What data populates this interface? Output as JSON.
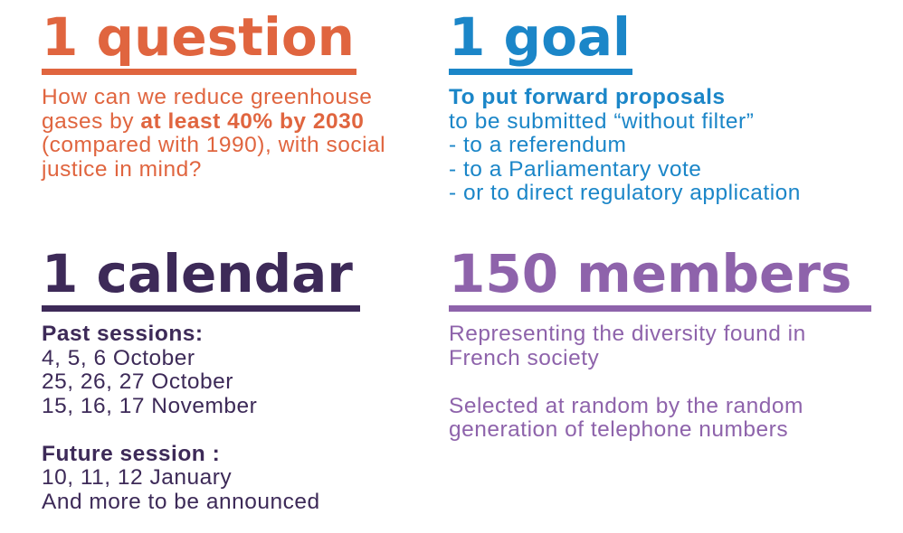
{
  "question": {
    "heading": "1 question",
    "text_a": "How can we reduce greenhouse gases by ",
    "text_bold": "at least 40% by 2030",
    "text_b": " (compared with 1990), with social justice in mind?",
    "color": "#e0653f"
  },
  "goal": {
    "heading": "1 goal",
    "lead": "To put forward proposals",
    "lines": [
      "to be submitted “without filter”",
      "- to a referendum",
      "- to a Parliamentary vote",
      "- or to direct regulatory application"
    ],
    "color": "#1b86c8"
  },
  "calendar": {
    "heading": "1 calendar",
    "past_label": "Past sessions:",
    "past_dates": [
      "4, 5, 6 October",
      "25, 26, 27 October",
      "15, 16, 17 November"
    ],
    "future_label": "Future session :",
    "future_dates": [
      "10, 11, 12 January",
      "And more to be announced"
    ],
    "color": "#3d2a58"
  },
  "members": {
    "heading": "150 members",
    "paragraph_1": "Representing the diversity found in French society",
    "paragraph_2": "Selected at random by the random generation of telephone numbers",
    "color": "#8e63ab"
  }
}
